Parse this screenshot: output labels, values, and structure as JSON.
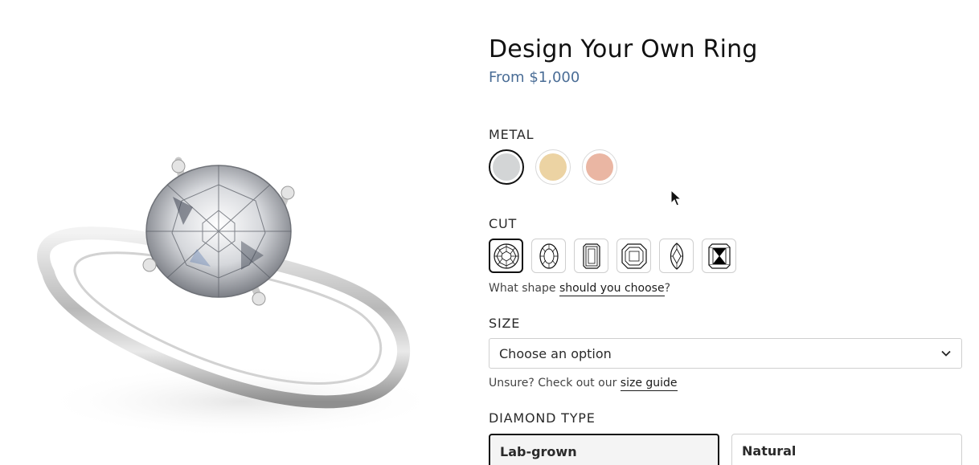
{
  "product": {
    "title": "Design Your Own Ring",
    "price": "From $1,000"
  },
  "metal": {
    "label": "METAL",
    "options": [
      {
        "name": "white-gold",
        "color": "#d3d5d6",
        "selected": true
      },
      {
        "name": "yellow-gold",
        "color": "#ecd3a3",
        "selected": false
      },
      {
        "name": "rose-gold",
        "color": "#eab6a3",
        "selected": false
      }
    ]
  },
  "cut": {
    "label": "CUT",
    "options": [
      {
        "icon": "round-cut-icon",
        "selected": true
      },
      {
        "icon": "oval-cut-icon",
        "selected": false
      },
      {
        "icon": "emerald-cut-icon",
        "selected": false
      },
      {
        "icon": "asscher-cut-icon",
        "selected": false
      },
      {
        "icon": "marquise-cut-icon",
        "selected": false
      },
      {
        "icon": "radiant-cut-icon",
        "selected": false
      }
    ],
    "hint_prefix": "What shape ",
    "hint_link": "should you choose",
    "hint_suffix": "?"
  },
  "size": {
    "label": "SIZE",
    "selected_value": "Choose an option",
    "hint_prefix": "Unsure? Check out our ",
    "hint_link": "size guide"
  },
  "diamond_type": {
    "label": "DIAMOND TYPE",
    "options": [
      "Lab-grown",
      "Natural"
    ],
    "selected": "Lab-grown"
  },
  "icons": {
    "dropdown": "chevron-down-icon",
    "cursor": "mouse-pointer-icon"
  },
  "colors": {
    "accent_price": "#4a6d96",
    "selected_border": "#111111"
  }
}
